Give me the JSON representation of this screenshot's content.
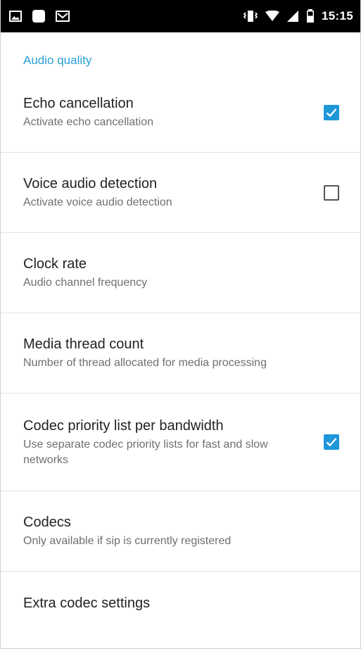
{
  "status_bar": {
    "time": "15:15",
    "left_icons": [
      "image-icon",
      "square-app-icon",
      "gmail-icon"
    ],
    "right_icons": [
      "vibrate-icon",
      "wifi-icon",
      "signal-icon",
      "battery-icon"
    ]
  },
  "section": {
    "title": "Audio quality"
  },
  "preferences": [
    {
      "title": "Echo cancellation",
      "summary": "Activate echo cancellation",
      "checkbox": "checked"
    },
    {
      "title": "Voice audio detection",
      "summary": "Activate voice audio detection",
      "checkbox": "unchecked"
    },
    {
      "title": "Clock rate",
      "summary": "Audio channel frequency",
      "checkbox": "none"
    },
    {
      "title": "Media thread count",
      "summary": "Number of thread allocated for media processing",
      "checkbox": "none"
    },
    {
      "title": "Codec priority list per bandwidth",
      "summary": "Use separate codec priority lists for fast and slow networks",
      "checkbox": "checked"
    },
    {
      "title": "Codecs",
      "summary": "Only available if sip is currently registered",
      "checkbox": "none"
    },
    {
      "title": "Extra codec settings",
      "summary": "",
      "checkbox": "none"
    }
  ],
  "colors": {
    "accent": "#2a9fd6",
    "checkbox_checked": "#1e96d8",
    "status_bar": "#000000"
  }
}
